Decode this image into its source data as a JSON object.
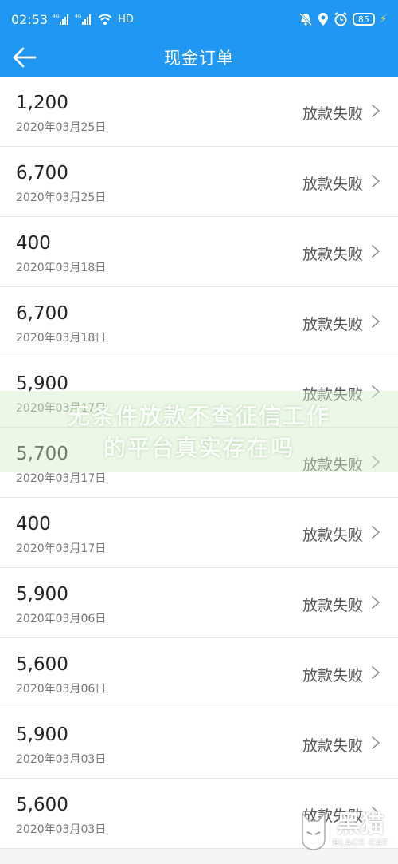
{
  "status_bar": {
    "time": "02:53",
    "signal1": "4G",
    "signal2": "4G",
    "network": "HD",
    "battery": "85"
  },
  "header": {
    "title": "现金订单",
    "back_icon": "arrow-left-icon"
  },
  "orders": [
    {
      "amount": "1,200",
      "date": "2020年03月25日",
      "status": "放款失败"
    },
    {
      "amount": "6,700",
      "date": "2020年03月25日",
      "status": "放款失败"
    },
    {
      "amount": "400",
      "date": "2020年03月18日",
      "status": "放款失败"
    },
    {
      "amount": "6,700",
      "date": "2020年03月18日",
      "status": "放款失败"
    },
    {
      "amount": "5,900",
      "date": "2020年03月17日",
      "status": "放款失败"
    },
    {
      "amount": "5,700",
      "date": "2020年03月17日",
      "status": "放款失败"
    },
    {
      "amount": "400",
      "date": "2020年03月17日",
      "status": "放款失败"
    },
    {
      "amount": "5,900",
      "date": "2020年03月06日",
      "status": "放款失败"
    },
    {
      "amount": "5,600",
      "date": "2020年03月06日",
      "status": "放款失败"
    },
    {
      "amount": "5,900",
      "date": "2020年03月03日",
      "status": "放款失败"
    },
    {
      "amount": "5,600",
      "date": "2020年03月03日",
      "status": "放款失败"
    }
  ],
  "watermark": {
    "line1": "无条件放款不查征信工作",
    "line2": "的平台真实存在吗"
  },
  "logo": {
    "big": "黑猫",
    "small": "BLACK CAT"
  },
  "colors": {
    "accent": "#1f97f3"
  }
}
